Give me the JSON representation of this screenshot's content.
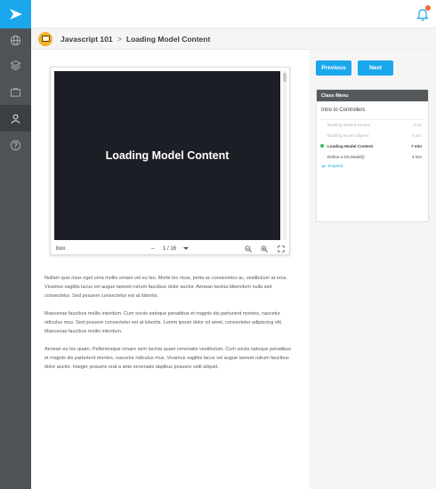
{
  "breadcrumb": {
    "course": "Javascript 101",
    "separator": ">",
    "lesson": "Loading Model Content"
  },
  "notifications": {
    "badge": "1"
  },
  "nav": {
    "buttons": {
      "previous": "Previous",
      "next": "Next"
    }
  },
  "class_menu": {
    "header": "Class Menu",
    "section": "Intro to Controllers",
    "items": [
      {
        "label": "Building Nested Routes",
        "duration": "6:45",
        "state": "done"
      },
      {
        "label": "Building Route Objects",
        "duration": "4 min",
        "state": "done"
      },
      {
        "label": "Loading Model Content",
        "duration": "7 min",
        "state": "current"
      },
      {
        "label": "Define a DS.Model()",
        "duration": "4 min",
        "state": "pending"
      }
    ],
    "expand": "Expand"
  },
  "viewer": {
    "title": "Loading Model Content",
    "brand": "box",
    "page_minus": "–",
    "page_count": "1 / 16"
  },
  "article": {
    "paragraphs": [
      "Nullam quis risus eget urna mollis ornare vel eu leo. Morbi leo risus, porta ac consectetur ac, vestibulum at eros. Vivamus sagittis lacus vel augue laoreet rutrum faucibus dolor auctor. Aenean lacinia bibendum nulla sed consectetur. Sed posuere consectetur est at lobortis.",
      "Maecenas faucibus mollis interdum. Cum sociis natoque penatibus et magnis dis parturient montes, nascetur ridiculus mus. Sed posuere consectetur est at lobortis. Lorem ipsum dolor sit amet, consectetur adipiscing elit. Maecenas faucibus mollis interdum.",
      "Aenean eu leo quam. Pellentesque ornare sem lacinia quam venenatis vestibulum. Cum sociis natoque penatibus et magnis dis parturient montes, nascetur ridiculus mus. Vivamus sagittis lacus vel augue laoreet rutrum faucibus dolor auctor. Integer posuere erat a ante venenatis dapibus posuere velit aliquet."
    ]
  },
  "icons": {
    "logo": "arrow-logo-icon",
    "sidebar": [
      "globe-icon",
      "layers-icon",
      "briefcase-icon",
      "user-icon",
      "help-icon"
    ],
    "bell": "bell-icon",
    "zoom_out": "zoom-out-icon",
    "zoom_in": "zoom-in-icon",
    "fullscreen": "fullscreen-icon"
  },
  "colors": {
    "accent": "#1aa7ec",
    "sidebar": "#4f5356",
    "stage": "#1c1e25",
    "progress_dot": "#2ebf6a",
    "course_icon": "#f3b229",
    "badge": "#f26a2e"
  }
}
